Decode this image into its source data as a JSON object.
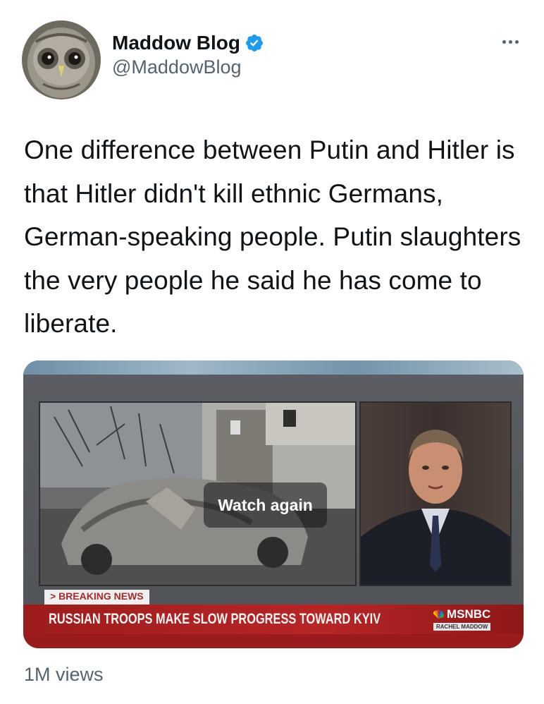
{
  "author": {
    "display_name": "Maddow Blog",
    "handle": "@MaddowBlog",
    "verified": true,
    "avatar_icon": "owl-avatar-icon"
  },
  "menu": {
    "more_icon": "more-dots-icon"
  },
  "tweet": {
    "text": "One difference between Putin and Hitler is that Hitler didn't kill ethnic Germans, German-speaking people. Putin slaughters the very people he said he has come to liberate."
  },
  "media": {
    "overlay_label": "Watch again",
    "breaking_label": "> BREAKING NEWS",
    "chyron_text": "RUSSIAN TROOPS MAKE SLOW PROGRESS TOWARD KYIV",
    "network_name": "MSNBC",
    "show_name": "RACHEL MADDOW"
  },
  "stats": {
    "views": "1M views"
  },
  "colors": {
    "text_primary": "#0f1419",
    "text_secondary": "#536471",
    "verified_blue": "#1d9bf0",
    "chyron_red": "#b82525"
  }
}
